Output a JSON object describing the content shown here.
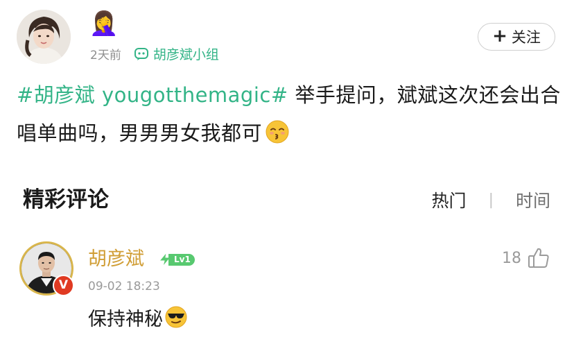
{
  "post": {
    "poster_emoji": "🤦‍♀️",
    "time": "2天前",
    "group_name": "胡彦斌小组",
    "follow_label": "关注",
    "follow_icon": "+",
    "hashtag": "#胡彦斌 yougotthemagic#",
    "text": " 举手提问，斌斌这次还会出合唱单曲吗，男男男女我都可",
    "text_emoji": "kissing-face-icon"
  },
  "comments_section": {
    "title": "精彩评论",
    "sort_hot": "热门",
    "sort_divider": "|",
    "sort_time": "时间"
  },
  "comment": {
    "username": "胡彦斌",
    "level": "Lv1",
    "verified_mark": "V",
    "time": "09-02 18:23",
    "text": "保持神秘",
    "text_emoji": "sunglasses-face-icon",
    "like_count": "18"
  },
  "colors": {
    "accent_green": "#33b487",
    "username_gold": "#d09d34",
    "verified_red": "#e03a22",
    "level_green": "#58c970"
  }
}
